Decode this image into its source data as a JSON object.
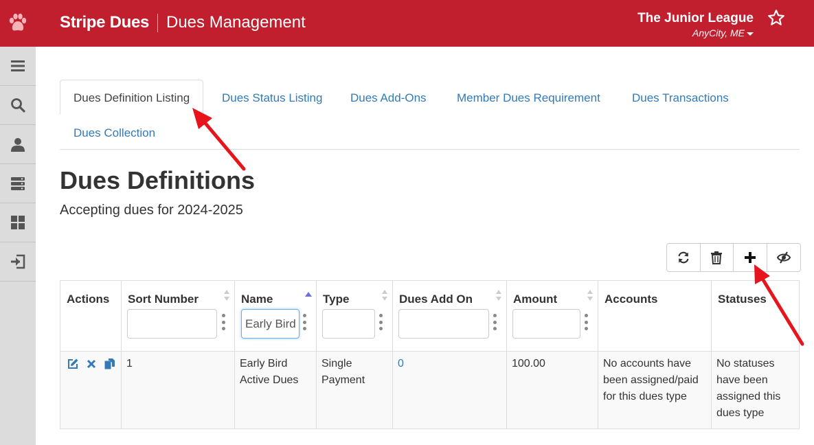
{
  "header": {
    "brand": "Stripe Dues",
    "module": "Dues Management",
    "org_name": "The Junior League",
    "org_location": "AnyCity, ME"
  },
  "sidebar": {
    "items": [
      {
        "icon": "menu-icon"
      },
      {
        "icon": "search-icon"
      },
      {
        "icon": "user-icon"
      },
      {
        "icon": "server-icon"
      },
      {
        "icon": "dashboard-icon"
      },
      {
        "icon": "logout-icon"
      }
    ]
  },
  "tabs": [
    {
      "label": "Dues Definition Listing",
      "active": true
    },
    {
      "label": "Dues Status Listing"
    },
    {
      "label": "Dues Add-Ons"
    },
    {
      "label": "Member Dues Requirement"
    },
    {
      "label": "Dues Transactions"
    },
    {
      "label": "Dues Collection"
    }
  ],
  "page": {
    "title": "Dues Definitions",
    "subtitle": "Accepting dues for 2024-2025"
  },
  "toolbar": {
    "buttons": [
      "refresh-icon",
      "trash-icon",
      "plus-icon",
      "visibility-icon"
    ]
  },
  "table": {
    "columns": [
      "Actions",
      "Sort Number",
      "Name",
      "Type",
      "Dues Add On",
      "Amount",
      "Accounts",
      "Statuses"
    ],
    "filters": {
      "name": "Early Bird"
    },
    "rows": [
      {
        "sort_number": "1",
        "name": "Early Bird Active Dues",
        "type": "Single Payment",
        "dues_add_on": "0",
        "amount": "100.00",
        "accounts": "No accounts have been assigned/paid for this dues type",
        "statuses": "No statuses have been assigned this dues type"
      }
    ]
  },
  "colors": {
    "brand_red": "#c11f2e",
    "link_blue": "#337ab7",
    "annotation_arrow": "#e8141b"
  }
}
